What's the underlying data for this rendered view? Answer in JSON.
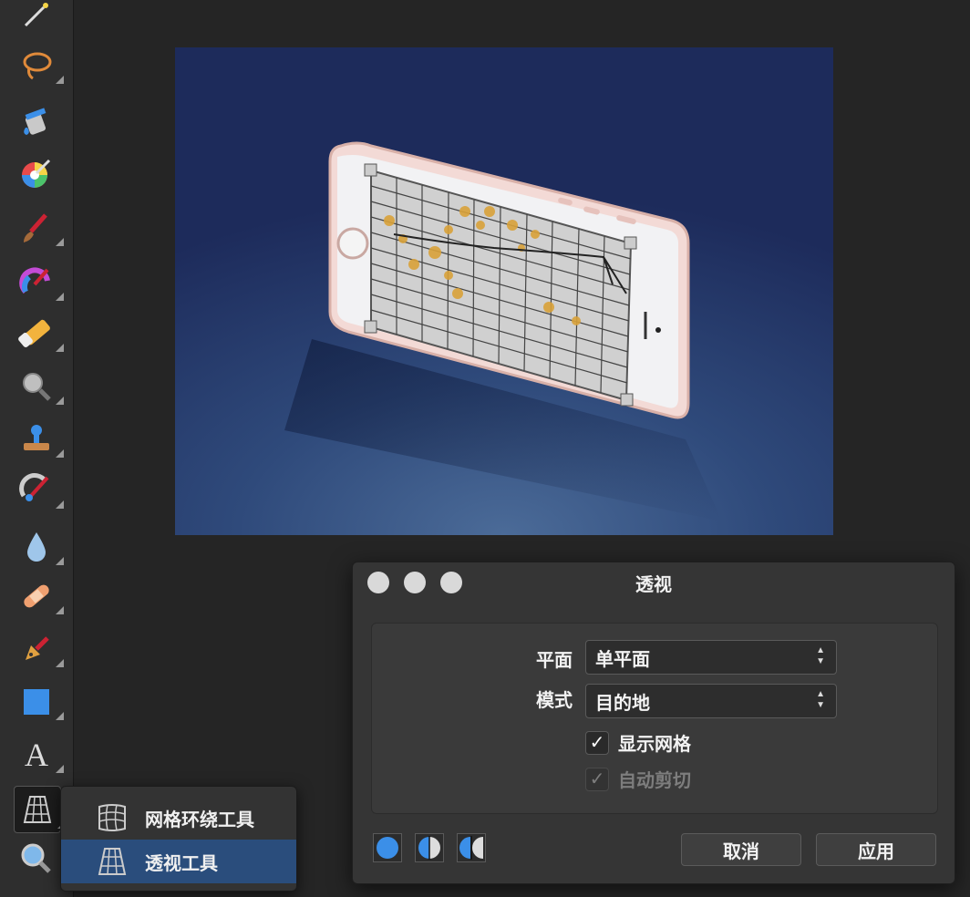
{
  "toolbar": {
    "tools": [
      {
        "name": "magic-wand-icon"
      },
      {
        "name": "lasso-icon"
      },
      {
        "name": "paint-bucket-icon"
      },
      {
        "name": "color-picker-icon"
      },
      {
        "name": "paint-brush-icon"
      },
      {
        "name": "color-replace-brush-icon"
      },
      {
        "name": "eraser-icon"
      },
      {
        "name": "zoom-icon"
      },
      {
        "name": "clone-stamp-icon"
      },
      {
        "name": "retouch-brush-icon"
      },
      {
        "name": "blur-drop-icon"
      },
      {
        "name": "healing-bandage-icon"
      },
      {
        "name": "pen-icon"
      },
      {
        "name": "rectangle-shape-icon"
      },
      {
        "name": "text-icon",
        "glyph": "A"
      },
      {
        "name": "perspective-grid-icon"
      },
      {
        "name": "magnifier-icon"
      }
    ]
  },
  "tool_menu": {
    "items": [
      {
        "label": "网格环绕工具",
        "icon": "mesh-warp-icon"
      },
      {
        "label": "透视工具",
        "icon": "perspective-icon"
      }
    ],
    "selected_index": 1
  },
  "dialog": {
    "title": "透视",
    "plane_label": "平面",
    "plane_value": "单平面",
    "mode_label": "模式",
    "mode_value": "目的地",
    "show_grid_label": "显示网格",
    "show_grid_checked": true,
    "auto_crop_label": "自动剪切",
    "auto_crop_checked": true,
    "auto_crop_disabled": true,
    "check_glyph": "✓",
    "select_arrows": "▲\n▼",
    "cancel_label": "取消",
    "apply_label": "应用"
  },
  "colors": {
    "selection": "#2a4d7c",
    "canvas_top": "#1d2b5b",
    "canvas_bottom": "#4b6b98",
    "phone_body": "#f3dad6",
    "accent_blue": "#3b8fe8"
  }
}
